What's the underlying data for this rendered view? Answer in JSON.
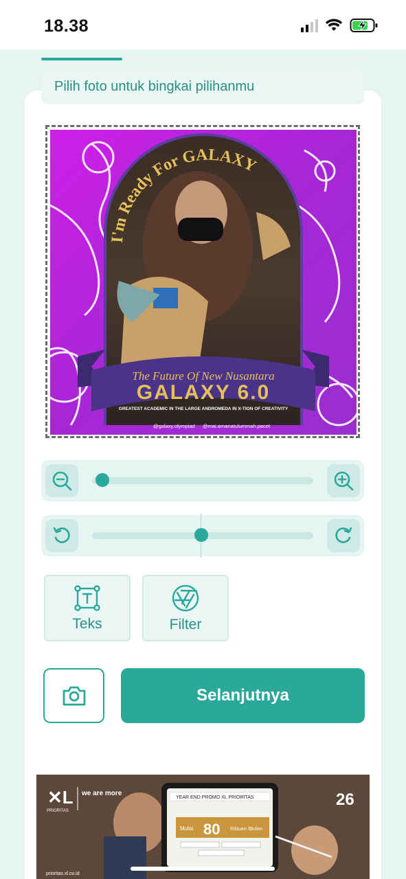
{
  "status_bar": {
    "time": "18.38"
  },
  "editor": {
    "hint": "Pilih foto untuk bingkai pilihanmu",
    "frame": {
      "headline_top": "I'm Ready For GALAXY",
      "subtitle": "The Future Of New Nusantara",
      "title": "GALAXY 6.0",
      "tagline": "GREATEST ACADEMIC IN THE LARGE ANDROMEDA IN X-TION OF CREATIVITY",
      "instagram_1": "@galaxy.olympiad",
      "instagram_2": "@mai.amanatulummah.pacet"
    },
    "zoom_slider": {
      "value": 0.04
    },
    "rotate_slider": {
      "value": 0.5
    },
    "tools": [
      {
        "label": "Teks"
      },
      {
        "label": "Filter"
      }
    ],
    "next_label": "Selanjutnya"
  },
  "ad": {
    "brand": "we are more",
    "brand_sub": "PRIORITAS",
    "promo_header": "YEAR END PROMO XL PRIORITAS",
    "price_prefix": "Mulai",
    "price_number": "80",
    "price_suffix": "Ribuan /Bulan",
    "anniversary": "26",
    "site": "prioritas.xl.co.id"
  },
  "colors": {
    "accent": "#2aa89a",
    "mint": "#e6f4f2",
    "frame_magenta": "#c21fe0"
  }
}
